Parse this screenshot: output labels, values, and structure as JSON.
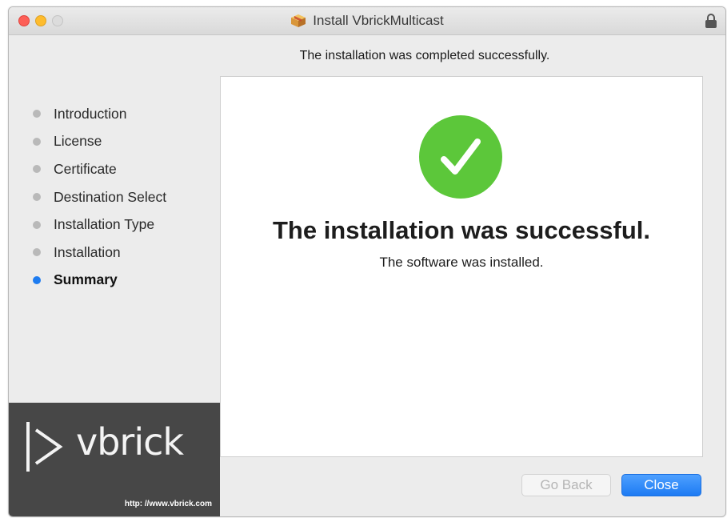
{
  "window": {
    "title": "Install VbrickMulticast"
  },
  "header": {
    "subtitle": "The installation was completed successfully."
  },
  "sidebar": {
    "steps": [
      {
        "label": "Introduction",
        "state": "done"
      },
      {
        "label": "License",
        "state": "done"
      },
      {
        "label": "Certificate",
        "state": "done"
      },
      {
        "label": "Destination Select",
        "state": "done"
      },
      {
        "label": "Installation Type",
        "state": "done"
      },
      {
        "label": "Installation",
        "state": "done"
      },
      {
        "label": "Summary",
        "state": "active"
      }
    ]
  },
  "brand": {
    "name": "vbrick",
    "url": "http: //www.vbrick.com"
  },
  "main": {
    "headline": "The installation was successful.",
    "message": "The software was installed."
  },
  "buttons": {
    "back_label": "Go Back",
    "close_label": "Close"
  },
  "colors": {
    "accent": "#1e7cf0",
    "success": "#5cc73a",
    "brand_bg": "#474747"
  },
  "icons": {
    "title": "package-icon",
    "lock": "lock-icon",
    "status": "success-check-icon",
    "logo": "vbrick-play-logo"
  }
}
